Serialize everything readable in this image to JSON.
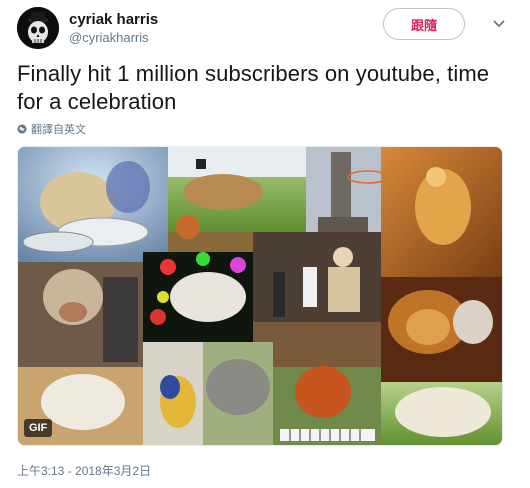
{
  "user": {
    "display_name": "cyriak harris",
    "handle": "@cyriakharris",
    "avatar_icon": "skull-bowler-hat-avatar"
  },
  "follow_button": {
    "label": "跟隨",
    "color": "#e0245e"
  },
  "menu": {
    "icon": "chevron-down-icon"
  },
  "tweet": {
    "text": "Finally hit 1 million subscribers on youtube, time for a celebration"
  },
  "translate": {
    "label": "翻譯自英文",
    "icon": "globe-icon"
  },
  "media": {
    "badge": "GIF"
  },
  "timestamp": "上午3:13 - 2018年3月2日"
}
